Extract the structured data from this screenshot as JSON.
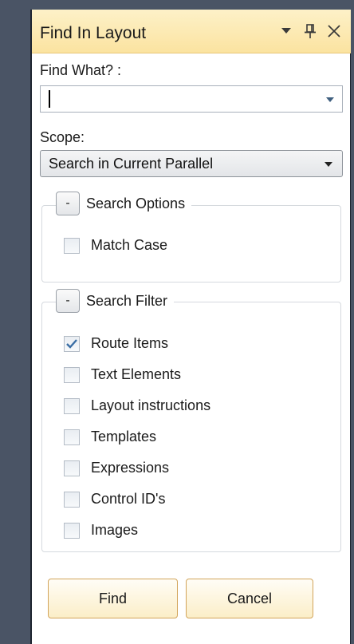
{
  "panel": {
    "title": "Find In Layout",
    "icons": [
      "dropdown-arrow-icon",
      "pin-icon",
      "close-icon"
    ]
  },
  "find_what": {
    "label": "Find What? :",
    "value": ""
  },
  "scope": {
    "label": "Scope:",
    "selected": "Search in Current Parallel"
  },
  "search_options": {
    "collapse_label": "-",
    "title": "Search Options",
    "items": [
      {
        "label": "Match Case",
        "checked": false
      }
    ]
  },
  "search_filter": {
    "collapse_label": "-",
    "title": "Search Filter",
    "items": [
      {
        "label": "Route Items",
        "checked": true
      },
      {
        "label": "Text Elements",
        "checked": false
      },
      {
        "label": "Layout instructions",
        "checked": false
      },
      {
        "label": "Templates",
        "checked": false
      },
      {
        "label": "Expressions",
        "checked": false
      },
      {
        "label": "Control ID's",
        "checked": false
      },
      {
        "label": "Images",
        "checked": false
      }
    ]
  },
  "buttons": {
    "find": "Find",
    "cancel": "Cancel"
  },
  "colors": {
    "frame": "#4a5465",
    "titlebar": "#fbe3a0",
    "button_border": "#d2a45a",
    "check": "#3a6ea5"
  }
}
